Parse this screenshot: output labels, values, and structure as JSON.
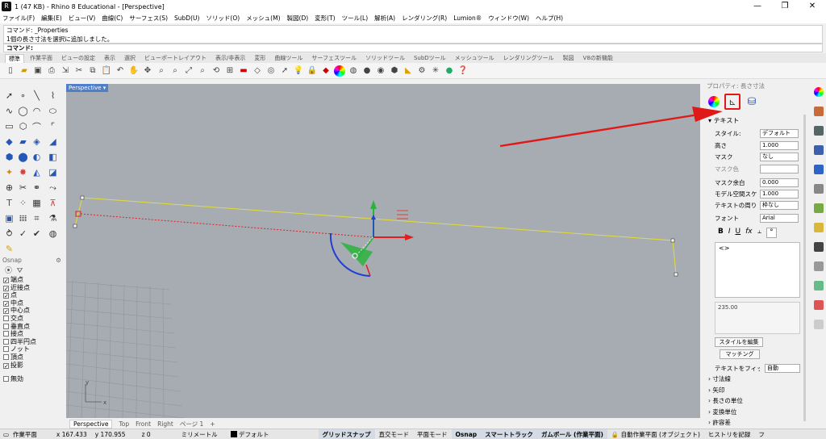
{
  "title": "1 (47 KB) - Rhino 8 Educational - [Perspective]",
  "window_controls": [
    "—",
    "❐",
    "✕"
  ],
  "menu": [
    "ファイル(F)",
    "編集(E)",
    "ビュー(V)",
    "曲線(C)",
    "サーフェス(S)",
    "SubD(U)",
    "ソリッド(O)",
    "メッシュ(M)",
    "製図(D)",
    "変形(T)",
    "ツール(L)",
    "解析(A)",
    "レンダリング(R)",
    "Lumion®",
    "ウィンドウ(W)",
    "ヘルプ(H)"
  ],
  "command_history": [
    "コマンド: _Properties",
    "1個の長さ寸法を選択に追加しました。"
  ],
  "command_prompt": "コマンド:",
  "toolbar_tabs": [
    "標準",
    "作業平面",
    "ビューの設定",
    "表示",
    "選択",
    "ビューポートレイアウト",
    "表示/非表示",
    "変形",
    "曲線ツール",
    "サーフェスツール",
    "ソリッドツール",
    "SubDツール",
    "メッシュツール",
    "レンダリングツール",
    "製図",
    "V8の新機能"
  ],
  "viewport": {
    "title": "Perspective",
    "tabs": [
      "Perspective",
      "Top",
      "Front",
      "Right",
      "ページ 1",
      "+"
    ]
  },
  "osnap": {
    "header": "Osnap",
    "items": [
      {
        "label": "端点",
        "checked": true
      },
      {
        "label": "近接点",
        "checked": true
      },
      {
        "label": "点",
        "checked": true
      },
      {
        "label": "中点",
        "checked": true
      },
      {
        "label": "中心点",
        "checked": true
      },
      {
        "label": "交点",
        "checked": false
      },
      {
        "label": "垂直点",
        "checked": false
      },
      {
        "label": "接点",
        "checked": false
      },
      {
        "label": "四半円点",
        "checked": false
      },
      {
        "label": "ノット",
        "checked": false
      },
      {
        "label": "頂点",
        "checked": false
      },
      {
        "label": "投影",
        "checked": true
      },
      {
        "label": "無効",
        "checked": false
      }
    ]
  },
  "properties": {
    "title": "プロパティ: 長さ寸法",
    "section_text": "テキスト",
    "rows": [
      {
        "label": "スタイル:",
        "value": "デフォルト"
      },
      {
        "label": "高さ",
        "value": "1.000"
      },
      {
        "label": "マスク",
        "value": "なし"
      },
      {
        "label": "マスク色",
        "value": ""
      },
      {
        "label": "マスク余白",
        "value": "0.000"
      },
      {
        "label": "モデル空間スケ",
        "value": "1.000"
      },
      {
        "label": "テキストの周り",
        "value": "枠なし"
      },
      {
        "label": "フォント",
        "value": "Arial"
      }
    ],
    "format_buttons": [
      "B",
      "I",
      "U",
      "fx",
      "⫠",
      "°"
    ],
    "text_content": "<>",
    "measured_value": "235.00",
    "btn_edit_style": "スタイルを編集",
    "btn_match": "マッチング",
    "fit_label": "テキストをフィット",
    "fit_value": "自動",
    "collapsed_sections": [
      "寸法線",
      "矢印",
      "長さの単位",
      "変換単位",
      "許容差"
    ]
  },
  "status": {
    "cplane": "作業平面",
    "x": "x 167.433",
    "y": "y 170.955",
    "z": "z 0",
    "units": "ミリメートル",
    "layer": "デフォルト",
    "grid_snap": "グリッドスナップ",
    "ortho": "直交モード",
    "planar": "平面モード",
    "osnap": "Osnap",
    "smarttrack": "スマートトラック",
    "gumball": "ガムボール (作業平面)",
    "autocplane": "自動作業平面 (オブジェクト)",
    "history": "ヒストリを記録",
    "filter": "フ"
  }
}
